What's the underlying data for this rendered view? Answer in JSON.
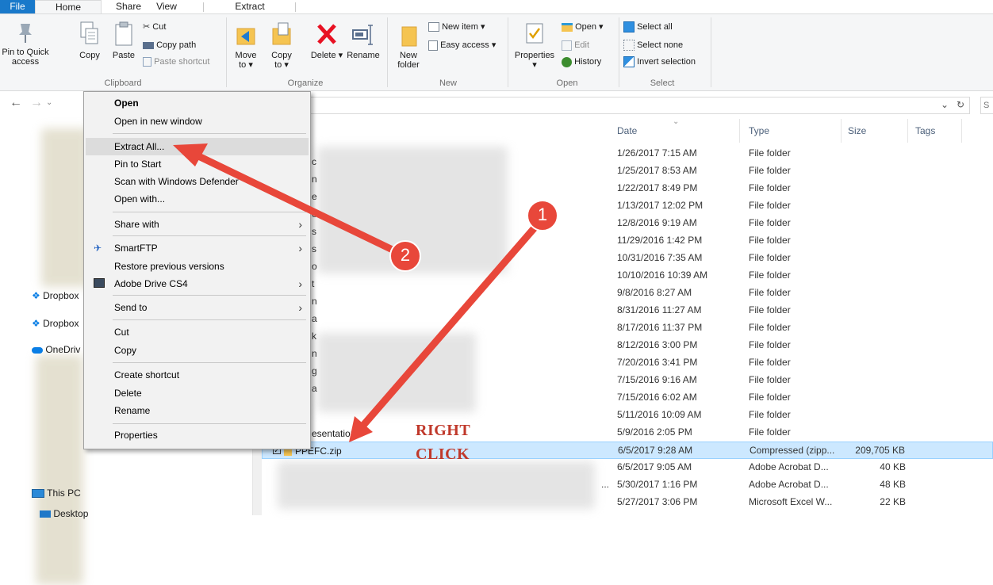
{
  "ribbon": {
    "tabs": {
      "file": "File",
      "home": "Home",
      "share": "Share",
      "view": "View",
      "extract": "Extract"
    },
    "clipboard": {
      "pin": "Pin to Quick access",
      "copy": "Copy",
      "paste": "Paste",
      "cut": "Cut",
      "copy_path": "Copy path",
      "paste_shortcut": "Paste shortcut",
      "label": "Clipboard"
    },
    "organize": {
      "move_to": "Move to ▾",
      "copy_to": "Copy to ▾",
      "delete": "Delete ▾",
      "rename": "Rename",
      "label": "Organize"
    },
    "new": {
      "new_folder": "New folder",
      "new_item": "New item ▾",
      "easy_access": "Easy access ▾",
      "label": "New"
    },
    "open": {
      "properties": "Properties ▾",
      "open": "Open ▾",
      "edit": "Edit",
      "history": "History",
      "label": "Open"
    },
    "select": {
      "select_all": "Select all",
      "select_none": "Select none",
      "invert": "Invert selection",
      "label": "Select"
    }
  },
  "search": {
    "text": "S"
  },
  "navpane": {
    "dropbox1": "Dropbox",
    "dropbox2": "Dropbox",
    "onedrive": "OneDriv",
    "this_pc": "This PC",
    "desktop": "Desktop"
  },
  "filelist": {
    "headers": {
      "date": "Date",
      "type": "Type",
      "size": "Size",
      "tags": "Tags"
    },
    "rows": [
      {
        "date": "1/26/2017 7:15 AM",
        "type": "File folder",
        "size": ""
      },
      {
        "date": "1/25/2017 8:53 AM",
        "type": "File folder",
        "size": ""
      },
      {
        "date": "1/22/2017 8:49 PM",
        "type": "File folder",
        "size": ""
      },
      {
        "date": "1/13/2017 12:02 PM",
        "type": "File folder",
        "size": ""
      },
      {
        "date": "12/8/2016 9:19 AM",
        "type": "File folder",
        "size": ""
      },
      {
        "date": "11/29/2016 1:42 PM",
        "type": "File folder",
        "size": ""
      },
      {
        "date": "10/31/2016 7:35 AM",
        "type": "File folder",
        "size": ""
      },
      {
        "date": "10/10/2016 10:39 AM",
        "type": "File folder",
        "size": ""
      },
      {
        "date": "9/8/2016 8:27 AM",
        "type": "File folder",
        "size": ""
      },
      {
        "date": "8/31/2016 11:27 AM",
        "type": "File folder",
        "size": ""
      },
      {
        "date": "8/17/2016 11:37 PM",
        "type": "File folder",
        "size": ""
      },
      {
        "date": "8/12/2016 3:00 PM",
        "type": "File folder",
        "size": ""
      },
      {
        "date": "7/20/2016 3:41 PM",
        "type": "File folder",
        "size": ""
      },
      {
        "date": "7/15/2016 9:16 AM",
        "type": "File folder",
        "size": ""
      },
      {
        "date": "7/15/2016 6:02 AM",
        "type": "File folder",
        "size": ""
      },
      {
        "date": "5/11/2016 10:09 AM",
        "type": "File folder",
        "size": ""
      },
      {
        "date": "5/9/2016 2:05 PM",
        "type": "File folder",
        "size": ""
      },
      {
        "date": "6/5/2017 9:28 AM",
        "type": "Compressed (zipp...",
        "size": "209,705 KB"
      },
      {
        "date": "6/5/2017 9:05 AM",
        "type": "Adobe Acrobat D...",
        "size": "40 KB"
      },
      {
        "date": "5/30/2017 1:16 PM",
        "type": "Adobe Acrobat D...",
        "size": "48 KB"
      },
      {
        "date": "5/27/2017 3:06 PM",
        "type": "Microsoft Excel W...",
        "size": "22 KB"
      }
    ],
    "partial_names": {
      "presentation": "esentation",
      "zip_name": "PPEFC.zip"
    },
    "partial_letters": [
      "c",
      "n",
      "e",
      "e",
      "s",
      "s",
      "o",
      "t",
      "n",
      "a",
      "k",
      "n",
      "g",
      "a"
    ]
  },
  "context_menu": {
    "open": "Open",
    "open_new_window": "Open in new window",
    "extract_all": "Extract All...",
    "pin_to_start": "Pin to Start",
    "scan_defender": "Scan with Windows Defender",
    "open_with": "Open with...",
    "share_with": "Share with",
    "smartftp": "SmartFTP",
    "restore_versions": "Restore previous versions",
    "adobe_drive": "Adobe Drive CS4",
    "send_to": "Send to",
    "cut": "Cut",
    "copy": "Copy",
    "create_shortcut": "Create shortcut",
    "delete": "Delete",
    "rename": "Rename",
    "properties": "Properties"
  },
  "annotations": {
    "badge1": "1",
    "badge2": "2",
    "right": "RIGHT",
    "click": "CLICK"
  },
  "colors": {
    "accent": "#1979ca",
    "arrow": "#e8473a",
    "selection": "#cce8ff",
    "annotation": "#c0392b"
  }
}
